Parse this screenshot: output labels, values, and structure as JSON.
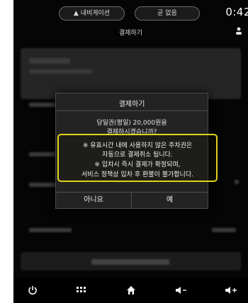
{
  "status_bar": {
    "nav_pill_label": "▲ 내비게이션",
    "music_pill_label": "곧 없음",
    "clock": "0:42"
  },
  "header": {
    "title": "결제하기"
  },
  "dialog": {
    "title": "결제하기",
    "message_line1": "당일권(평일) 20,000원을",
    "message_line2": "결제하시겠습니까?",
    "notice_lines": [
      "※ 유효시간 내에 사용하지 않은 주차권은",
      "자동으로 결제취소 됩니다.",
      "※ 입차시 즉시 결제가 확정되며,",
      "서비스 정책상 입차 후 환불이 불가합니다."
    ],
    "notice_color": "#e2d21b",
    "cancel_label": "아니요",
    "confirm_label": "예"
  },
  "bottom_nav": {
    "icons": [
      "power-icon",
      "apps-grid-icon",
      "home-icon",
      "volume-down-icon",
      "volume-up-icon"
    ]
  }
}
